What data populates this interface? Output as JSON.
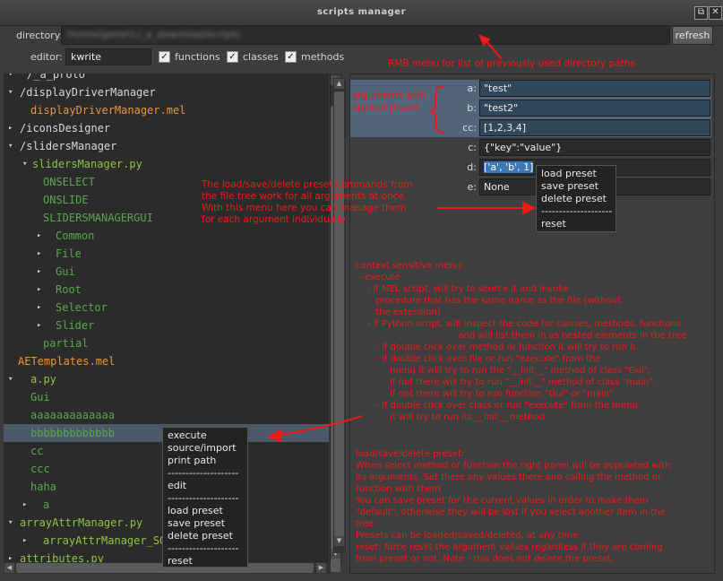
{
  "window": {
    "title": "scripts manager",
    "buttons": [
      "⧉",
      "✕"
    ]
  },
  "toolbar": {
    "directory_label": "directory:",
    "directory_value": "/home/generic/_a_download/scripts",
    "refresh_label": "refresh",
    "editor_label": "editor:",
    "editor_value": "kwrite",
    "checkboxes": [
      {
        "label": "functions",
        "checked": true
      },
      {
        "label": "classes",
        "checked": true
      },
      {
        "label": "methods",
        "checked": true
      }
    ]
  },
  "tree": [
    {
      "label": "/_a_proto",
      "color": "#d8d8d8"
    },
    {
      "label": "/displayDriverManager",
      "color": "#d8d8d8"
    },
    {
      "label": "displayDriverManager.mel",
      "color": "#e6953c"
    },
    {
      "label": "/iconsDesigner",
      "color": "#d8d8d8"
    },
    {
      "label": "/slidersManager",
      "color": "#d8d8d8"
    },
    {
      "label": "slidersManager.py",
      "color": "#8cc63f"
    },
    {
      "label": "ONSELECT",
      "color": "#58a84c"
    },
    {
      "label": "ONSLIDE",
      "color": "#58a84c"
    },
    {
      "label": "SLIDERSMANAGERGUI",
      "color": "#58a84c"
    },
    {
      "label": "Common",
      "color": "#58a84c"
    },
    {
      "label": "File",
      "color": "#58a84c"
    },
    {
      "label": "Gui",
      "color": "#58a84c"
    },
    {
      "label": "Root",
      "color": "#58a84c"
    },
    {
      "label": "Selector",
      "color": "#58a84c"
    },
    {
      "label": "Slider",
      "color": "#58a84c"
    },
    {
      "label": "partial",
      "color": "#58a84c"
    },
    {
      "label": "AETemplates.mel",
      "color": "#e6953c"
    },
    {
      "label": "a.py",
      "color": "#8cc63f"
    },
    {
      "label": "Gui",
      "color": "#58a84c"
    },
    {
      "label": "aaaaaaaaaaaaa",
      "color": "#58a84c"
    },
    {
      "label": "bbbbbbbbbbbbb",
      "color": "#58a84c"
    },
    {
      "label": "cc",
      "color": "#58a84c"
    },
    {
      "label": "ccc",
      "color": "#58a84c"
    },
    {
      "label": "haha",
      "color": "#58a84c"
    },
    {
      "label": "a",
      "color": "#58a84c"
    },
    {
      "label": "arrayAttrManager.py",
      "color": "#8cc63f"
    },
    {
      "label": "arrayAttrManager_SOul",
      "color": "#8cc63f"
    },
    {
      "label": "attributes.py",
      "color": "#8cc63f"
    }
  ],
  "left_menu": {
    "items": [
      "execute",
      "source/import",
      "print path",
      "--------------------",
      "edit",
      "--------------------",
      "load preset",
      "save preset",
      "delete preset",
      "--------------------",
      "reset"
    ]
  },
  "args": [
    {
      "label": "a:",
      "value": "\"test\""
    },
    {
      "label": "b:",
      "value": "\"test2\""
    },
    {
      "label": "cc:",
      "value": "[1,2,3,4]"
    },
    {
      "label": "c:",
      "value": "{\"key\":\"value\"}"
    },
    {
      "label": "d:",
      "value": "['a', 'b', 1]"
    },
    {
      "label": "e:",
      "value": "None"
    }
  ],
  "right_menu": {
    "items": [
      "load preset",
      "save preset",
      "delete preset",
      "--------------------",
      "reset"
    ]
  },
  "annotations": {
    "rmb": "RMB menu for list of previously used directory paths",
    "applied": "arguments with\napplied preset",
    "preset_menu": "The load/save/delete preset commands from\nthe file tree work for all arguments at once.\nWith this menu here you can manage them\nfor each argument individually.",
    "context": "context sensitive menu:\n - execute\n    - if MEL script, will try to source it and invoke\n       procedure that has the same name as the file (without\n       the extension)\n    - if Python script, will inspect the code for classes, methods, functions\n                                    and will list them in as nested elements in the tree\n       - if double click over method or function it will try to run it.\n       - if double click over file or run \"execute\" from the\n            menu it will try to run the \"__init__\" method of class \"Gui\",\n            if not there will try to run \"__init__\" method of class \"main\",\n            if not there will try to run function \"Gui\" or \"main\"\n       - if double click over class or run \"execute\" from the menu\n            it will try to run its __init__ method",
    "presets": "load/save/delete preset:\nWhen select method or function the right panel will be populated with\nits arguments. Set there any values there and calling the method or\nfunction with them.\nYou can save preset for the current values in order to make them\n\"default\", otherwise they will be lost if you select another item in the\ntree.\nPresets can be loaded/saved/deleted, at any time\nreset: force reset the argument values regardless if they are coming\nfrom preset or not. Note - this does not delete the preset."
  },
  "colors": {
    "annotation": "#ee1a1a",
    "folder": "#d8d8d8",
    "mel_file": "#e6953c",
    "py_file": "#8cc63f",
    "py_member": "#58a84c",
    "selection": "#4a5867"
  }
}
